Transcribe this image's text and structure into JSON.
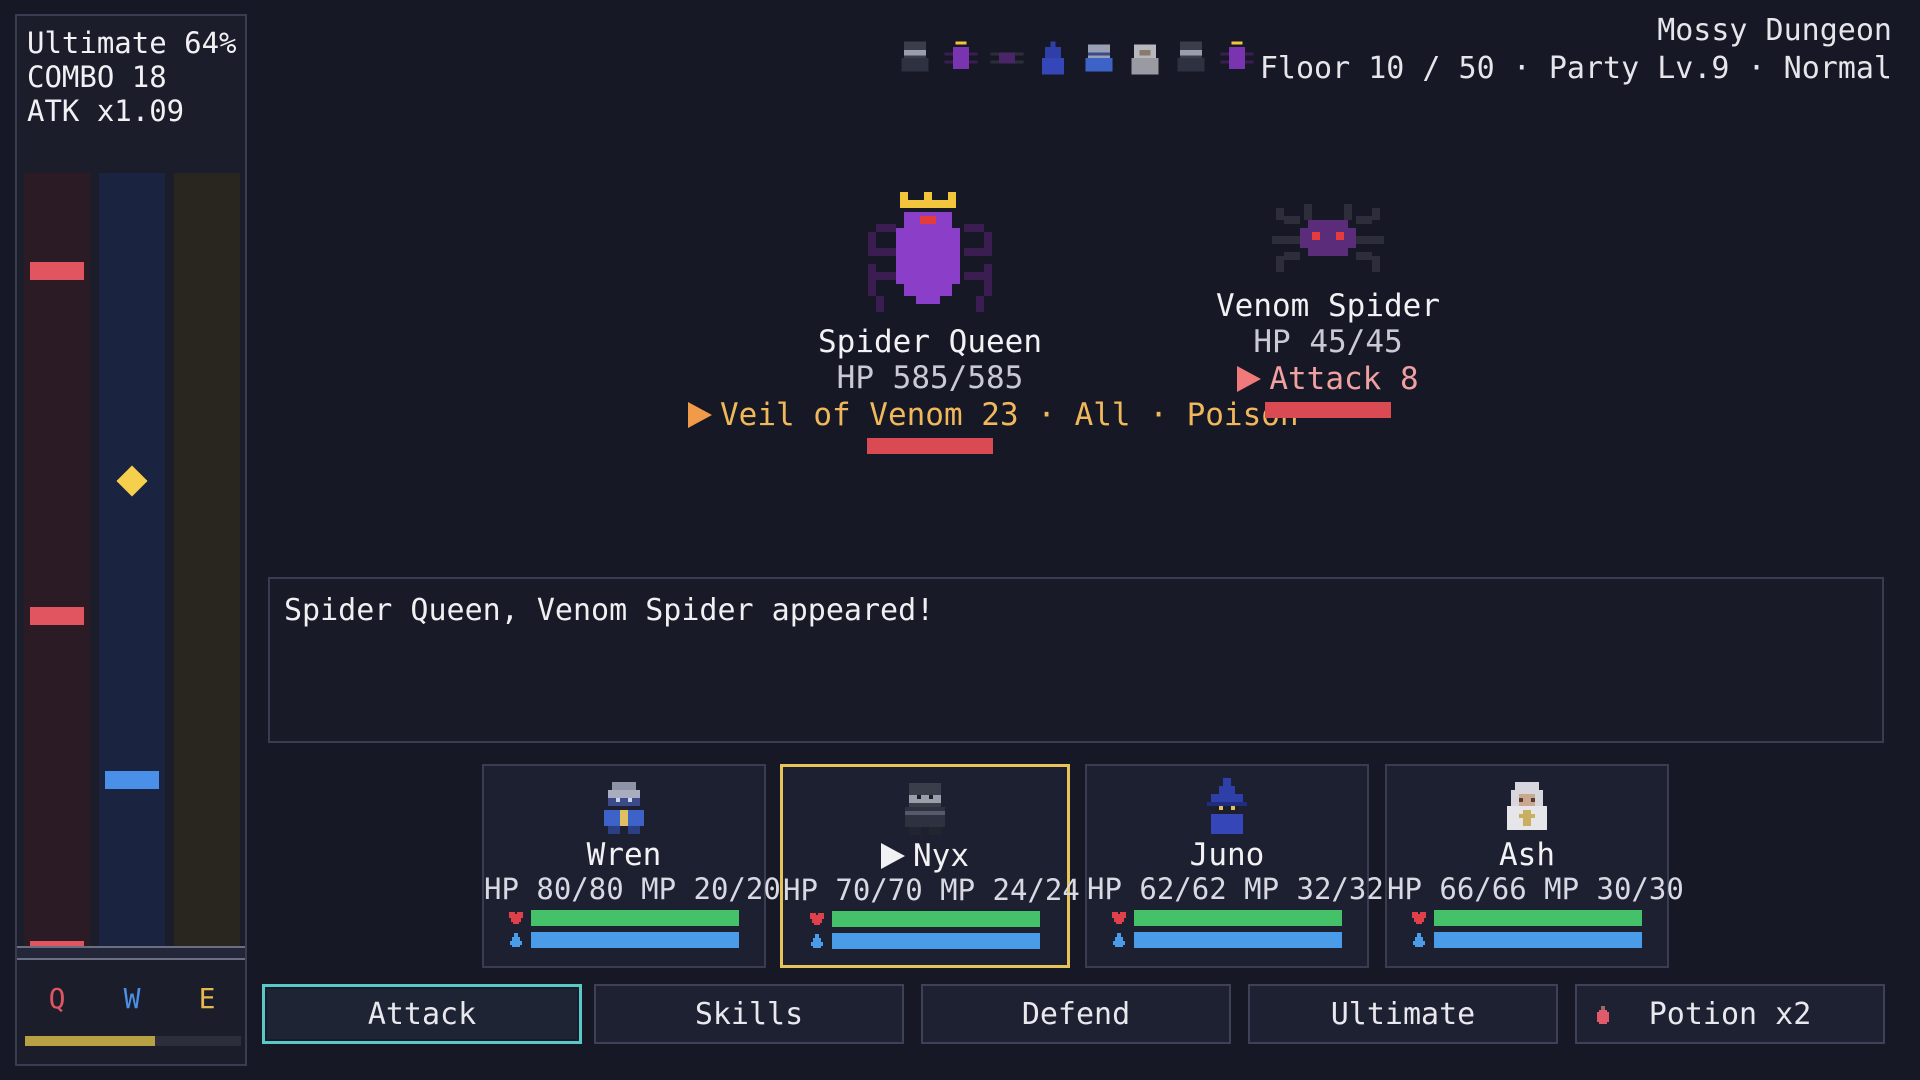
{
  "stats": {
    "ultimate": "Ultimate 64%",
    "combo": "COMBO 18",
    "atk": "ATK x1.09"
  },
  "rhythm": {
    "keys": [
      "Q",
      "W",
      "E"
    ],
    "charge": 0.6
  },
  "turn_order": [
    "ninja-icon",
    "spider-queen-icon",
    "spider-icon",
    "wizard-icon",
    "knight-icon",
    "cleric-icon",
    "ninja-icon",
    "spider-queen-icon"
  ],
  "dungeon": {
    "name": "Mossy Dungeon",
    "info": "Floor 10 / 50 · Party Lv.9 · Normal"
  },
  "enemies": [
    {
      "name": "Spider Queen",
      "hp": "HP 585/585",
      "intent": "Veil of Venom 23 · All · Poison",
      "hp_fraction": 1.0
    },
    {
      "name": "Venom Spider",
      "hp": "HP 45/45",
      "intent": "Attack 8",
      "hp_fraction": 1.0
    }
  ],
  "log": {
    "message": "Spider Queen, Venom Spider appeared!"
  },
  "party": [
    {
      "name": "Wren",
      "stats": "HP 80/80  MP 20/20",
      "hp_fraction": 1.0,
      "mp_fraction": 1.0,
      "active": false
    },
    {
      "name": "Nyx",
      "stats": "HP 70/70  MP 24/24",
      "hp_fraction": 1.0,
      "mp_fraction": 1.0,
      "active": true
    },
    {
      "name": "Juno",
      "stats": "HP 62/62  MP 32/32",
      "hp_fraction": 1.0,
      "mp_fraction": 1.0,
      "active": false
    },
    {
      "name": "Ash",
      "stats": "HP 66/66  MP 30/30",
      "hp_fraction": 1.0,
      "mp_fraction": 1.0,
      "active": false
    }
  ],
  "actions": {
    "attack": "Attack",
    "skills": "Skills",
    "defend": "Defend",
    "ultimate": "Ultimate",
    "potion": "Potion x2"
  },
  "colors": {
    "accent_selected": "#58c8c8",
    "active_member": "#e6c45a",
    "hp_bar": "#45c16a",
    "mp_bar": "#4a9be8",
    "enemy_hp": "#d94a52"
  }
}
